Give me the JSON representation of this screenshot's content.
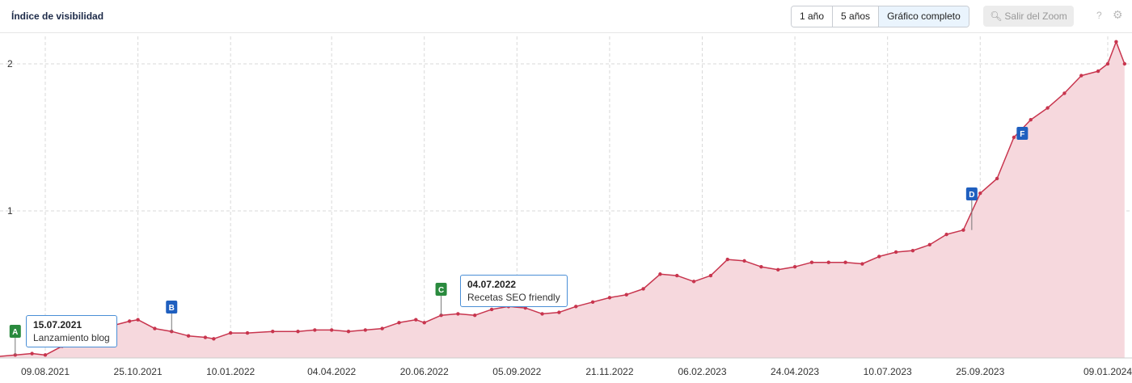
{
  "header": {
    "title": "Índice de visibilidad",
    "range_buttons": [
      "1 año",
      "5 años",
      "Gráfico completo"
    ],
    "zoom_button": "Salir del Zoom",
    "help": "?",
    "settings": "⚙"
  },
  "tooltips": [
    {
      "date": "15.07.2021",
      "text": "Lanzamiento blog"
    },
    {
      "date": "04.07.2022",
      "text": "Recetas SEO friendly"
    }
  ],
  "colors": {
    "line": "#c8354e",
    "area": "#f4d5da",
    "grid": "#d4d4d4",
    "marker_green": "#2a8a3e",
    "marker_blue": "#1f5fbf"
  },
  "chart_data": {
    "type": "area",
    "ylim": [
      0,
      2.2
    ],
    "yticks": [
      1,
      2
    ],
    "grid": true,
    "xtick_labels": [
      "09.08.2021",
      "25.10.2021",
      "10.01.2022",
      "04.04.2022",
      "20.06.2022",
      "05.09.2022",
      "21.11.2022",
      "06.02.2023",
      "24.04.2023",
      "10.07.2023",
      "25.09.2023",
      "09.01.2024"
    ],
    "series": [
      {
        "points": [
          [
            "2021-07-01",
            0.01
          ],
          [
            "2021-07-15",
            0.02
          ],
          [
            "2021-07-29",
            0.03
          ],
          [
            "2021-08-09",
            0.02
          ],
          [
            "2021-08-23",
            0.08
          ],
          [
            "2021-09-06",
            0.14
          ],
          [
            "2021-09-20",
            0.18
          ],
          [
            "2021-10-04",
            0.22
          ],
          [
            "2021-10-18",
            0.25
          ],
          [
            "2021-10-25",
            0.26
          ],
          [
            "2021-11-08",
            0.2
          ],
          [
            "2021-11-22",
            0.18
          ],
          [
            "2021-12-06",
            0.15
          ],
          [
            "2021-12-20",
            0.14
          ],
          [
            "2021-12-27",
            0.13
          ],
          [
            "2022-01-10",
            0.17
          ],
          [
            "2022-01-24",
            0.17
          ],
          [
            "2022-02-14",
            0.18
          ],
          [
            "2022-03-07",
            0.18
          ],
          [
            "2022-03-21",
            0.19
          ],
          [
            "2022-04-04",
            0.19
          ],
          [
            "2022-04-18",
            0.18
          ],
          [
            "2022-05-02",
            0.19
          ],
          [
            "2022-05-16",
            0.2
          ],
          [
            "2022-05-30",
            0.24
          ],
          [
            "2022-06-13",
            0.26
          ],
          [
            "2022-06-20",
            0.24
          ],
          [
            "2022-07-04",
            0.29
          ],
          [
            "2022-07-18",
            0.3
          ],
          [
            "2022-08-01",
            0.29
          ],
          [
            "2022-08-15",
            0.33
          ],
          [
            "2022-08-29",
            0.35
          ],
          [
            "2022-09-12",
            0.34
          ],
          [
            "2022-09-26",
            0.3
          ],
          [
            "2022-10-10",
            0.31
          ],
          [
            "2022-10-24",
            0.35
          ],
          [
            "2022-11-07",
            0.38
          ],
          [
            "2022-11-21",
            0.41
          ],
          [
            "2022-12-05",
            0.43
          ],
          [
            "2022-12-19",
            0.47
          ],
          [
            "2023-01-02",
            0.57
          ],
          [
            "2023-01-16",
            0.56
          ],
          [
            "2023-01-30",
            0.52
          ],
          [
            "2023-02-13",
            0.56
          ],
          [
            "2023-02-27",
            0.67
          ],
          [
            "2023-03-13",
            0.66
          ],
          [
            "2023-03-27",
            0.62
          ],
          [
            "2023-04-10",
            0.6
          ],
          [
            "2023-04-24",
            0.62
          ],
          [
            "2023-05-08",
            0.65
          ],
          [
            "2023-05-22",
            0.65
          ],
          [
            "2023-06-05",
            0.65
          ],
          [
            "2023-06-19",
            0.64
          ],
          [
            "2023-07-03",
            0.69
          ],
          [
            "2023-07-17",
            0.72
          ],
          [
            "2023-07-31",
            0.73
          ],
          [
            "2023-08-14",
            0.77
          ],
          [
            "2023-08-28",
            0.84
          ],
          [
            "2023-09-11",
            0.87
          ],
          [
            "2023-09-25",
            1.12
          ],
          [
            "2023-10-09",
            1.22
          ],
          [
            "2023-10-23",
            1.5
          ],
          [
            "2023-11-06",
            1.62
          ],
          [
            "2023-11-20",
            1.7
          ],
          [
            "2023-12-04",
            1.8
          ],
          [
            "2023-12-18",
            1.92
          ],
          [
            "2024-01-01",
            1.95
          ],
          [
            "2024-01-09",
            2.0
          ],
          [
            "2024-01-16",
            2.15
          ],
          [
            "2024-01-23",
            2.0
          ]
        ]
      }
    ],
    "markers": [
      {
        "label": "A",
        "date": "2021-07-15",
        "color": "green"
      },
      {
        "label": "B",
        "date": "2021-11-22",
        "color": "blue"
      },
      {
        "label": "C",
        "date": "2022-07-04",
        "color": "green"
      },
      {
        "label": "D",
        "date": "2023-09-18",
        "color": "blue"
      },
      {
        "label": "F",
        "date": "2023-10-30",
        "color": "blue"
      }
    ]
  }
}
